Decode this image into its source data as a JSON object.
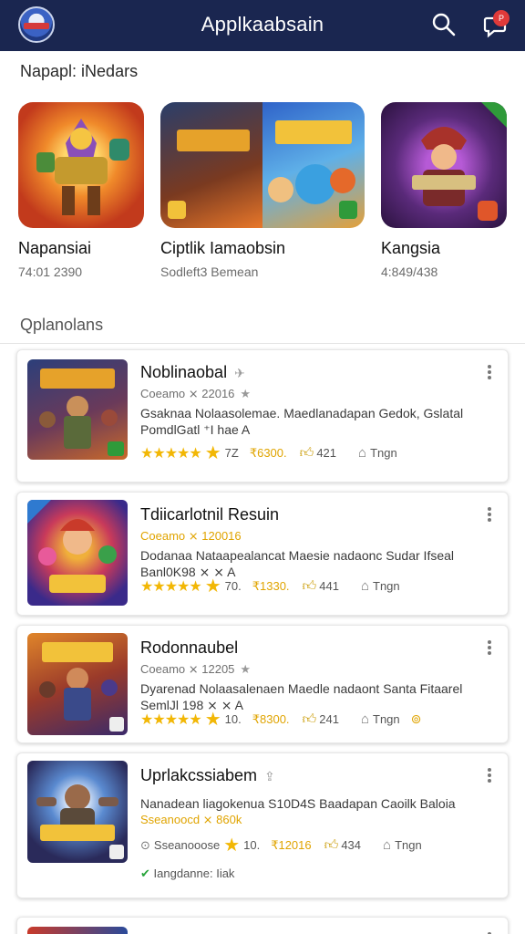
{
  "app": {
    "title": "Applkaabsain"
  },
  "featured": {
    "heading": "Napapl: iNedars",
    "items": [
      {
        "name": "Napansiai",
        "sub": "74:01 2390"
      },
      {
        "name": "Ciptlik Iamaobsin",
        "sub": "Sodleft3 Bemean"
      },
      {
        "name": "Kangsia",
        "sub": "4:849/438"
      }
    ]
  },
  "list_section": {
    "heading": "Qplanolans"
  },
  "cards": [
    {
      "title": "Noblinaobal",
      "meta": "Coeamo ⨯ 22016",
      "desc_line1": "Gsaknaa Nolaasolemae. Maedlanadapan Gedok, Gslatal",
      "desc_line2": "PomdlGatl ⁺I hae A",
      "stars_text": "★★★★★",
      "rating": "7Z",
      "price": "₹6300.",
      "likes": "421",
      "tag": "Tngn"
    },
    {
      "title": "Tdiicarlotnil Resuin",
      "meta": "Coeamo ⨯ 120016",
      "desc_line1": "Dodanaa Nataapealancat Maesie nadaonc Sudar Ifseal",
      "desc_line2": "Banl0K98 ⨯ ⨯ A",
      "stars_text": "★★★★★",
      "rating": "70.",
      "price": "₹1330.",
      "likes": "441",
      "tag": "Tngn"
    },
    {
      "title": "Rodonnaubel",
      "meta": "Coeamo ⨯ 12205",
      "desc_line1": "Dyarenad Nolaasalenaen Maedle nadaont Santa Fitaarel",
      "desc_line2": "SemlJl 198 ⨯ ⨯ A",
      "stars_text": "★★★★★",
      "rating": "10.",
      "price": "₹8300.",
      "likes": "241",
      "tag": "Tngn"
    },
    {
      "title": "Uprlakcssiabem",
      "meta": "Sseanoocd ⨯ 860k",
      "desc_line1": "Nanadean liagokenua S10D4S Baadapan Caoilk Baloia",
      "desc_line2": "",
      "meta_row": "Sseanooose",
      "rating": "10.",
      "price": "₹12016",
      "likes": "434",
      "tag": "Tngn",
      "status": "Iangdanne: Iiak"
    }
  ],
  "colors": {
    "header_bg": "#1a2650",
    "star": "#f2b705",
    "price": "#e0a400",
    "status_green": "#27a43a"
  },
  "icons": [
    "search-icon",
    "chat-notification-icon",
    "kebab-menu-icon",
    "star-icon",
    "thumbs-up-icon",
    "tag-icon",
    "check-circle-icon"
  ]
}
